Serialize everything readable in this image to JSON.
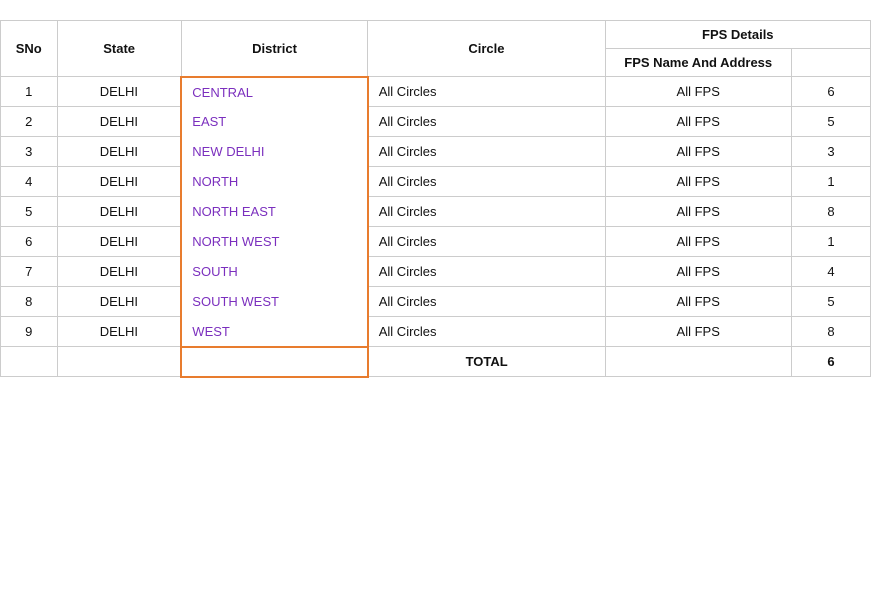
{
  "table": {
    "headers": {
      "sno": "SNo",
      "state": "State",
      "district": "District",
      "circle": "Circle",
      "fps_details": "FPS Details",
      "fps_name": "FPS Name And Address",
      "extra": ""
    },
    "rows": [
      {
        "sno": "1",
        "state": "DELHI",
        "district": "CENTRAL",
        "circle": "All Circles",
        "fps": "All FPS",
        "extra": "6"
      },
      {
        "sno": "2",
        "state": "DELHI",
        "district": "EAST",
        "circle": "All Circles",
        "fps": "All FPS",
        "extra": "5"
      },
      {
        "sno": "3",
        "state": "DELHI",
        "district": "NEW DELHI",
        "circle": "All Circles",
        "fps": "All FPS",
        "extra": "3"
      },
      {
        "sno": "4",
        "state": "DELHI",
        "district": "NORTH",
        "circle": "All Circles",
        "fps": "All FPS",
        "extra": "1"
      },
      {
        "sno": "5",
        "state": "DELHI",
        "district": "NORTH EAST",
        "circle": "All Circles",
        "fps": "All FPS",
        "extra": "8"
      },
      {
        "sno": "6",
        "state": "DELHI",
        "district": "NORTH WEST",
        "circle": "All Circles",
        "fps": "All FPS",
        "extra": "1"
      },
      {
        "sno": "7",
        "state": "DELHI",
        "district": "SOUTH",
        "circle": "All Circles",
        "fps": "All FPS",
        "extra": "4"
      },
      {
        "sno": "8",
        "state": "DELHI",
        "district": "SOUTH WEST",
        "circle": "All Circles",
        "fps": "All FPS",
        "extra": "5"
      },
      {
        "sno": "9",
        "state": "DELHI",
        "district": "WEST",
        "circle": "All Circles",
        "fps": "All FPS",
        "extra": "8"
      }
    ],
    "total": {
      "label": "TOTAL",
      "value": "6"
    }
  }
}
